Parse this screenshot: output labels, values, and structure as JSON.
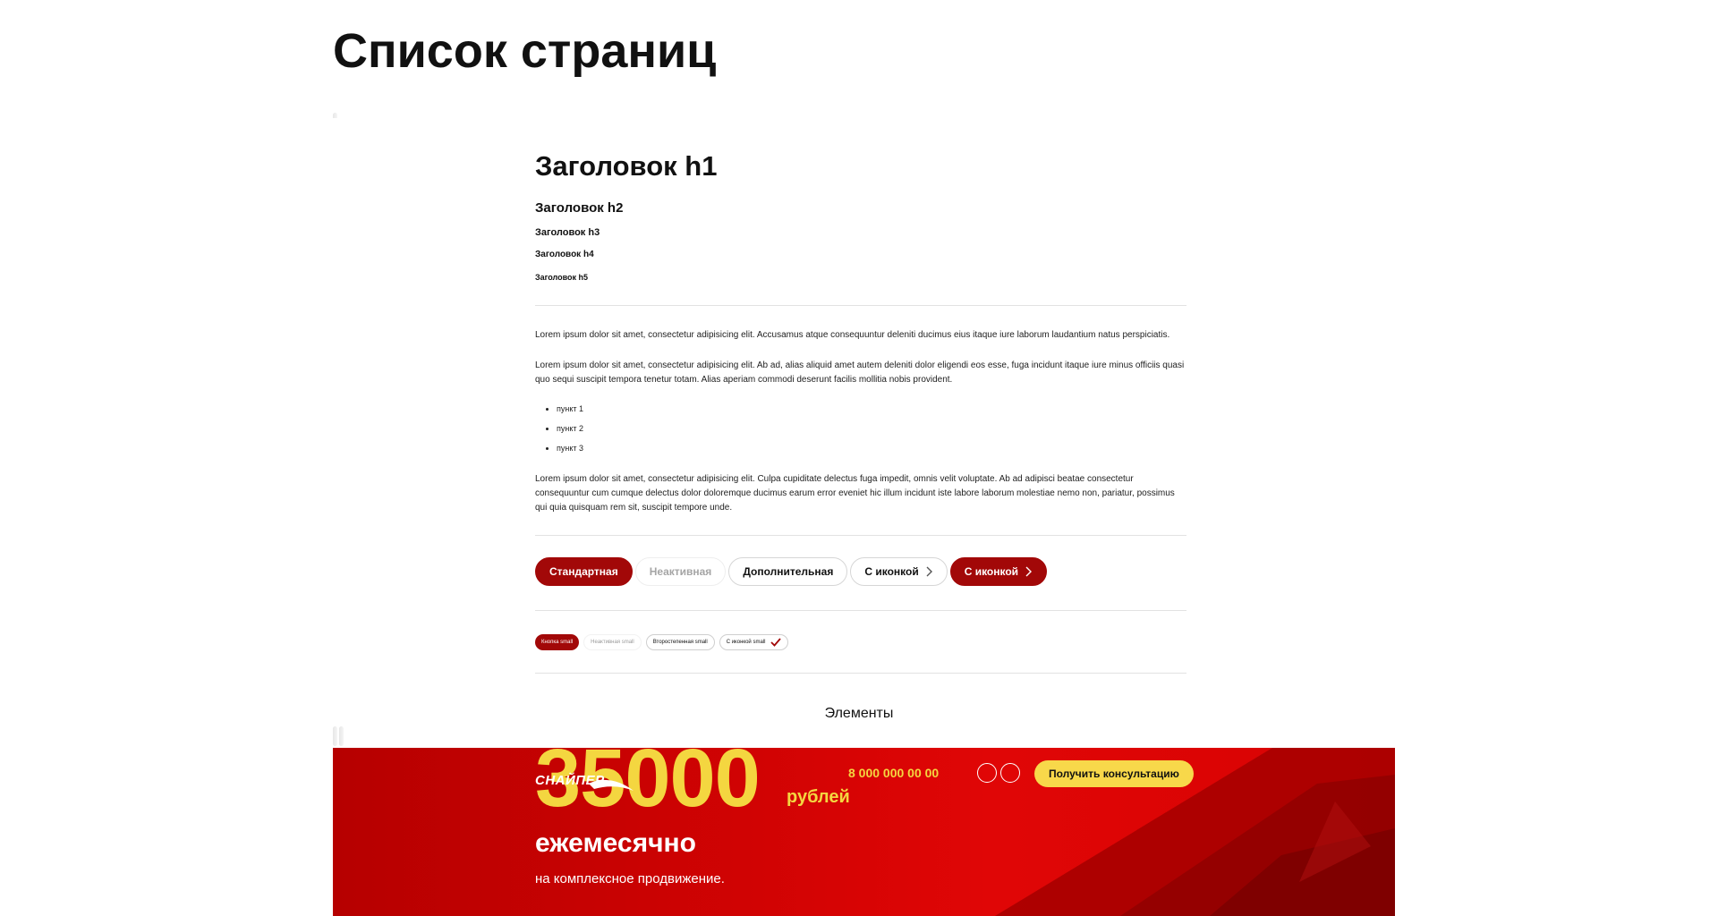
{
  "page": {
    "title": "Список страниц"
  },
  "preview": {
    "headings": {
      "h1": "Заголовок h1",
      "h2": "Заголовок h2",
      "h3": "Заголовок h3",
      "h4": "Заголовок h4",
      "h5": "Заголовок h5"
    },
    "paragraphs": [
      "Lorem ipsum dolor sit amet, consectetur adipisicing elit. Accusamus atque consequuntur deleniti ducimus eius itaque iure laborum laudantium natus perspiciatis.",
      "Lorem ipsum dolor sit amet, consectetur adipisicing elit. Ab ad, alias aliquid amet autem deleniti dolor eligendi eos esse, fuga incidunt itaque iure minus officiis quasi quo sequi suscipit tempora tenetur totam. Alias aperiam commodi deserunt facilis mollitia nobis provident.",
      "Lorem ipsum dolor sit amet, consectetur adipisicing elit. Culpa cupiditate delectus fuga impedit, omnis velit voluptate. Ab ad adipisci beatae consectetur consequuntur cum cumque delectus dolor doloremque ducimus earum error eveniet hic illum incidunt iste labore laborum molestiae nemo non, pariatur, possimus qui quia quisquam rem sit, suscipit tempore unde."
    ],
    "list": [
      "пункт 1",
      "пункт 2",
      "пункт 3"
    ],
    "buttons": {
      "standard": "Стандартная",
      "inactive": "Неактивная",
      "additional": "Дополнительная",
      "with_icon_outline": "С иконкой",
      "with_icon_filled": "С иконкой"
    },
    "small_buttons": {
      "primary": "Кнопка small",
      "inactive": "Неактивная small",
      "secondary": "Второстепенная small",
      "with_icon": "С иконкой small"
    }
  },
  "preview_label": "Элементы",
  "banner": {
    "logo_text": "СНАЙПЕР",
    "amount": "35000",
    "currency": "рублей",
    "period": "ежемесячно",
    "subtitle": "на комплексное продвижение.",
    "phone": "8 000 000 00 00",
    "cta": "Получить консультацию"
  },
  "colors": {
    "accent": "#a20808",
    "banner_red": "#d80303",
    "banner_yellow": "#f4d640",
    "cta_yellow": "#f8d84a"
  },
  "icons": [
    "chevron-right-icon",
    "check-icon",
    "social-icon"
  ]
}
